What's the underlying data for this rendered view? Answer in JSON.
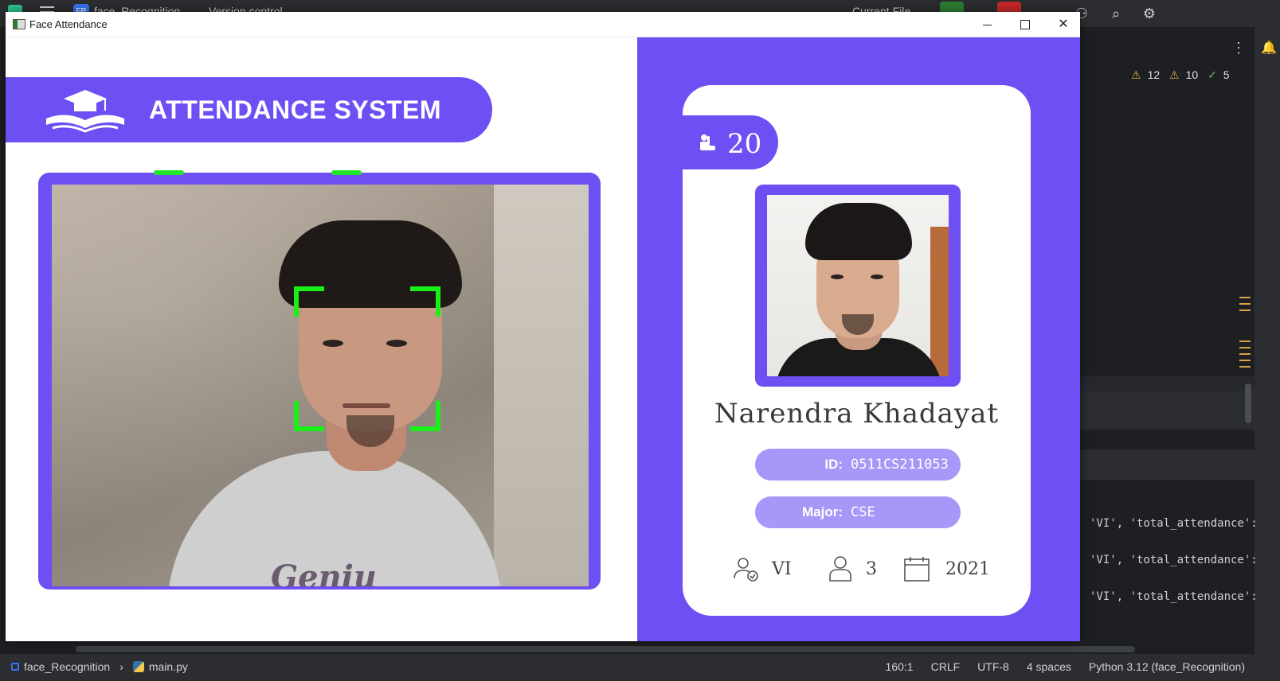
{
  "ide": {
    "project_badge": "FR",
    "project_name": "face_Recognition",
    "vcs": "Version control",
    "run_config": "Current File",
    "warnings": {
      "warn_a": "12",
      "warn_b": "10",
      "ok": "5"
    },
    "console_lines": [
      "'VI', 'total_attendance':",
      "'VI', 'total_attendance':",
      "'VI', 'total_attendance':"
    ],
    "breadcrumb": {
      "project": "face_Recognition",
      "file": "main.py"
    },
    "status": {
      "position": "160:1",
      "line_sep": "CRLF",
      "encoding": "UTF-8",
      "indent": "4 spaces",
      "interpreter": "Python 3.12 (face_Recognition)"
    }
  },
  "window": {
    "title": "Face Attendance",
    "minimize": "",
    "maximize": "",
    "close": "✕"
  },
  "banner": {
    "title": "ATTENDANCE SYSTEM",
    "icon": "graduation-book-icon"
  },
  "camera": {
    "shirt_text": "Geniu",
    "face_detected": true
  },
  "student": {
    "total_attendance": "20",
    "name": "Narendra Khadayat",
    "id_label": "ID:",
    "id_value": "0511CS211053",
    "major_label": "Major:",
    "major_value": "CSE",
    "standing": "VI",
    "year": "3",
    "starting_year": "2021"
  },
  "colors": {
    "accent": "#6d4ff3",
    "pill": "#a896f8",
    "detect_box": "#18f018"
  }
}
